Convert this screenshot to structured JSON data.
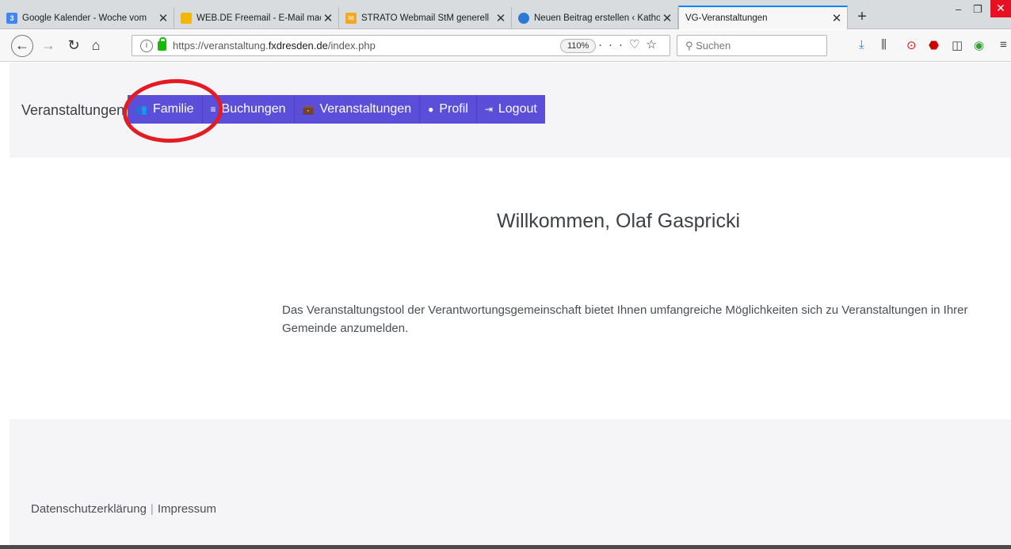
{
  "browser": {
    "tabs": [
      {
        "title": "Google Kalender - Woche vom",
        "favicon_text": "3",
        "favicon_color": "#4285f4"
      },
      {
        "title": "WEB.DE Freemail - E-Mail mac",
        "favicon_text": "",
        "favicon_color": "#f2b705"
      },
      {
        "title": "STRATO Webmail StM generell",
        "favicon_text": "",
        "favicon_color": "#f5a623"
      },
      {
        "title": "Neuen Beitrag erstellen ‹ Katho",
        "favicon_text": "",
        "favicon_color": "#2a7bd6"
      },
      {
        "title": "VG-Veranstaltungen",
        "favicon_text": "",
        "favicon_color": ""
      }
    ],
    "url_prefix": "https://veranstaltung.",
    "url_host": "fxdresden.de",
    "url_path": "/index.php",
    "zoom": "110%",
    "search_placeholder": "Suchen"
  },
  "page": {
    "brand": "Veranstaltungen",
    "menu": [
      {
        "label": "Familie",
        "icon": "users-icon"
      },
      {
        "label": "Buchungen",
        "icon": "list-icon"
      },
      {
        "label": "Veranstaltungen",
        "icon": "briefcase-icon"
      },
      {
        "label": "Profil",
        "icon": "user-circle-icon"
      },
      {
        "label": "Logout",
        "icon": "logout-icon"
      }
    ],
    "welcome": "Willkommen, Olaf Gaspricki",
    "intro": "Das Veranstaltungstool der Verantwortungsgemeinschaft bietet Ihnen umfangreiche Möglichkeiten sich zu Veranstaltungen in Ihrer Gemeinde anzumelden.",
    "footer": {
      "privacy": "Datenschutzerklärung",
      "separator": "|",
      "imprint": "Impressum"
    }
  },
  "colors": {
    "menu_bg": "#5b4fd9",
    "highlight": "#e41b23",
    "hero_bg": "#f5f5f7"
  }
}
